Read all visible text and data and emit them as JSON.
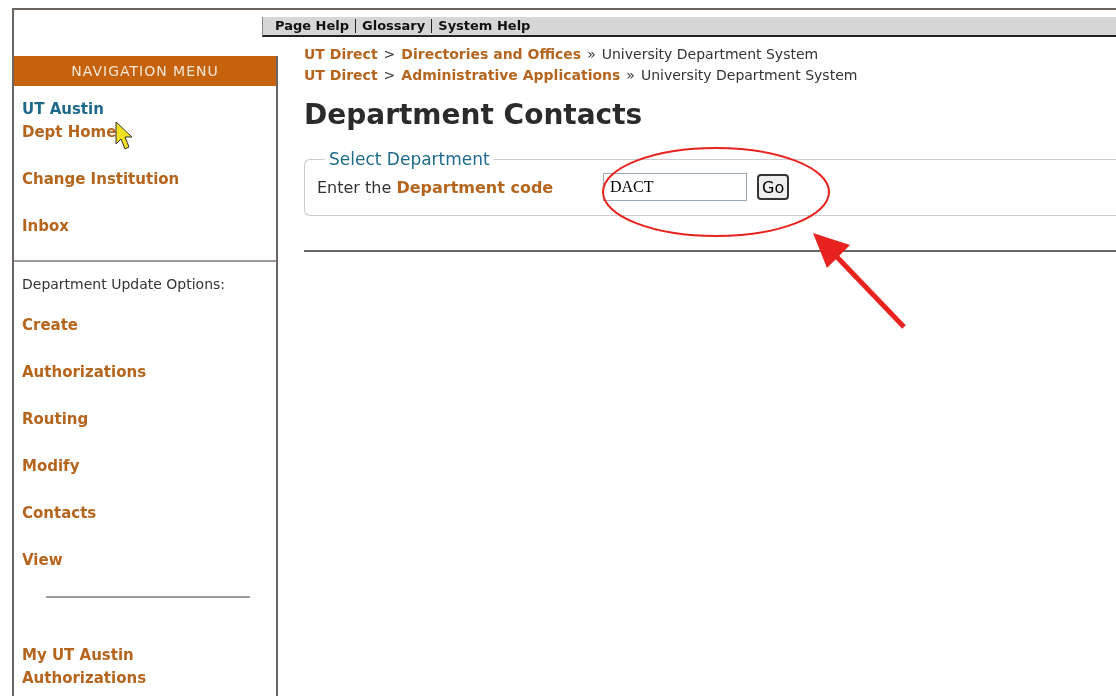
{
  "help_links": [
    "Page Help",
    "Glossary",
    "System Help"
  ],
  "nav": {
    "header": "NAVIGATION MENU",
    "items": [
      {
        "kind": "home",
        "text": "UT Austin"
      },
      {
        "kind": "link",
        "text": "Dept Home"
      },
      {
        "kind": "link",
        "text": "Change Institution"
      },
      {
        "kind": "link",
        "text": "Inbox"
      },
      {
        "kind": "divider"
      },
      {
        "kind": "label",
        "text": "Department Update Options:"
      },
      {
        "kind": "link",
        "text": "Create"
      },
      {
        "kind": "link",
        "text": "Authorizations"
      },
      {
        "kind": "link",
        "text": "Routing"
      },
      {
        "kind": "link",
        "text": "Modify"
      },
      {
        "kind": "link",
        "text": "Contacts"
      },
      {
        "kind": "link",
        "text": "View"
      },
      {
        "kind": "short-divider"
      },
      {
        "kind": "link",
        "text": "My UT Austin Authorizations"
      }
    ]
  },
  "breadcrumbs": [
    {
      "links": [
        "UT Direct",
        "Directories and Offices"
      ],
      "separator": ">",
      "current_separator": "»",
      "current": "University Department System"
    },
    {
      "links": [
        "UT Direct",
        "Administrative Applications"
      ],
      "separator": ">",
      "current_separator": "»",
      "current": "University Department System"
    }
  ],
  "page_title": "Department Contacts",
  "form": {
    "legend": "Select Department",
    "prompt": "Enter the **Department code**",
    "value": "DACT",
    "button": "Go"
  }
}
